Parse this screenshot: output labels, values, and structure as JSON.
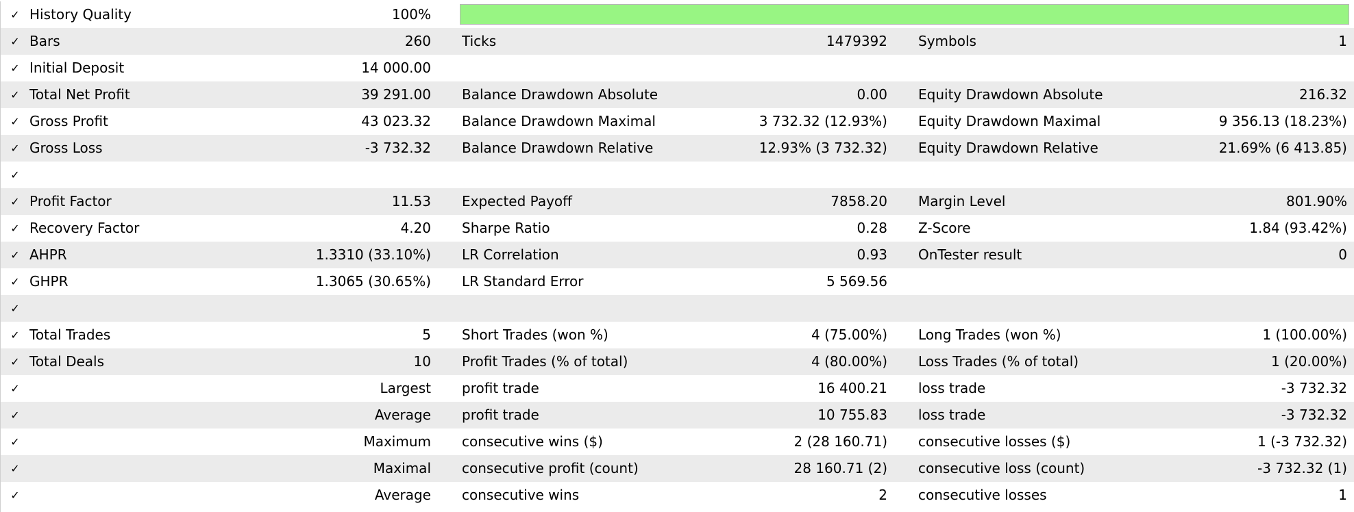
{
  "colors": {
    "quality_bar_fill": "#98f583",
    "alt_row_background": "#ebebeb",
    "row_background": "#ffffff"
  },
  "check_icon": "checkmark-icon",
  "history_quality": {
    "label": "History Quality",
    "value": "100%",
    "bar_fraction": 1.0
  },
  "rows": [
    {
      "c1": "Bars",
      "v1": "260",
      "c2": "Ticks",
      "v2": "1479392",
      "c3": "Symbols",
      "v3": "1"
    },
    {
      "c1": "Initial Deposit",
      "v1": "14 000.00",
      "c2": "",
      "v2": "",
      "c3": "",
      "v3": ""
    },
    {
      "c1": "Total Net Profit",
      "v1": "39 291.00",
      "c2": "Balance Drawdown Absolute",
      "v2": "0.00",
      "c3": "Equity Drawdown Absolute",
      "v3": "216.32"
    },
    {
      "c1": "Gross Profit",
      "v1": "43 023.32",
      "c2": "Balance Drawdown Maximal",
      "v2": "3 732.32 (12.93%)",
      "c3": "Equity Drawdown Maximal",
      "v3": "9 356.13 (18.23%)"
    },
    {
      "c1": "Gross Loss",
      "v1": "-3 732.32",
      "c2": "Balance Drawdown Relative",
      "v2": "12.93% (3 732.32)",
      "c3": "Equity Drawdown Relative",
      "v3": "21.69% (6 413.85)"
    },
    {
      "c1": "",
      "v1": "",
      "c2": "",
      "v2": "",
      "c3": "",
      "v3": ""
    },
    {
      "c1": "Profit Factor",
      "v1": "11.53",
      "c2": "Expected Payoff",
      "v2": "7858.20",
      "c3": "Margin Level",
      "v3": "801.90%"
    },
    {
      "c1": "Recovery Factor",
      "v1": "4.20",
      "c2": "Sharpe Ratio",
      "v2": "0.28",
      "c3": "Z-Score",
      "v3": "1.84 (93.42%)"
    },
    {
      "c1": "AHPR",
      "v1": "1.3310 (33.10%)",
      "c2": "LR Correlation",
      "v2": "0.93",
      "c3": "OnTester result",
      "v3": "0"
    },
    {
      "c1": "GHPR",
      "v1": "1.3065 (30.65%)",
      "c2": "LR Standard Error",
      "v2": "5 569.56",
      "c3": "",
      "v3": ""
    },
    {
      "c1": "",
      "v1": "",
      "c2": "",
      "v2": "",
      "c3": "",
      "v3": ""
    },
    {
      "c1": "Total Trades",
      "v1": "5",
      "c2": "Short Trades (won %)",
      "v2": "4 (75.00%)",
      "c3": "Long Trades (won %)",
      "v3": "1 (100.00%)"
    },
    {
      "c1": "Total Deals",
      "v1": "10",
      "c2": "Profit Trades (% of total)",
      "v2": "4 (80.00%)",
      "c3": "Loss Trades (% of total)",
      "v3": "1 (20.00%)"
    },
    {
      "c1": "",
      "v1": "Largest",
      "c2": "profit trade",
      "v2": "16 400.21",
      "c3": "loss trade",
      "v3": "-3 732.32"
    },
    {
      "c1": "",
      "v1": "Average",
      "c2": "profit trade",
      "v2": "10 755.83",
      "c3": "loss trade",
      "v3": "-3 732.32"
    },
    {
      "c1": "",
      "v1": "Maximum",
      "c2": "consecutive wins ($)",
      "v2": "2 (28 160.71)",
      "c3": "consecutive losses ($)",
      "v3": "1 (-3 732.32)"
    },
    {
      "c1": "",
      "v1": "Maximal",
      "c2": "consecutive profit (count)",
      "v2": "28 160.71 (2)",
      "c3": "consecutive loss (count)",
      "v3": "-3 732.32 (1)"
    },
    {
      "c1": "",
      "v1": "Average",
      "c2": "consecutive wins",
      "v2": "2",
      "c3": "consecutive losses",
      "v3": "1"
    }
  ]
}
